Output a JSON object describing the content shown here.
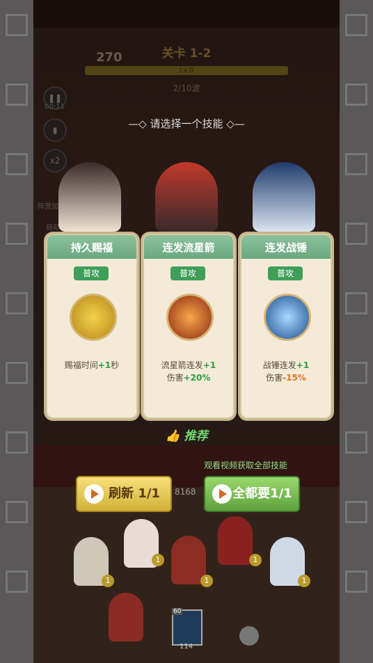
{
  "hud": {
    "score": "270",
    "level_title": "关卡 1-2",
    "level_bar": "Lv.0",
    "wave": "2/10波",
    "timer": "00:11",
    "speed": "x2",
    "camp_bonus": "阵营加成",
    "auto": "自动"
  },
  "prompt": "请选择一个技能",
  "cards": [
    {
      "title": "持久赐福",
      "tag": "普攻",
      "desc_prefix": "赐福时间",
      "desc_value": "+1",
      "desc_suffix": "秒",
      "desc2_prefix": "",
      "desc2_value": "",
      "icon": "gold-ingot-icon"
    },
    {
      "title": "连发流星箭",
      "tag": "普攻",
      "desc_prefix": "流星箭连发",
      "desc_value": "+1",
      "desc_suffix": "",
      "desc2_prefix": "伤害",
      "desc2_value": "+20%",
      "icon": "meteor-arrow-icon"
    },
    {
      "title": "连发战锤",
      "tag": "普攻",
      "desc_prefix": "战锤连发",
      "desc_value": "+1",
      "desc_suffix": "",
      "desc2_prefix": "伤害",
      "desc2_value": "-15%",
      "icon": "war-hammer-icon"
    }
  ],
  "recommend": "推荐",
  "watch_text": "观看视频获取全部技能",
  "buttons": {
    "refresh": "刷新 1/1",
    "take_all": "全都要1/1"
  },
  "coins": "8168",
  "units": [
    "1",
    "1",
    "1",
    "1",
    "1"
  ],
  "card_cost": "60",
  "bottom_count": "114"
}
